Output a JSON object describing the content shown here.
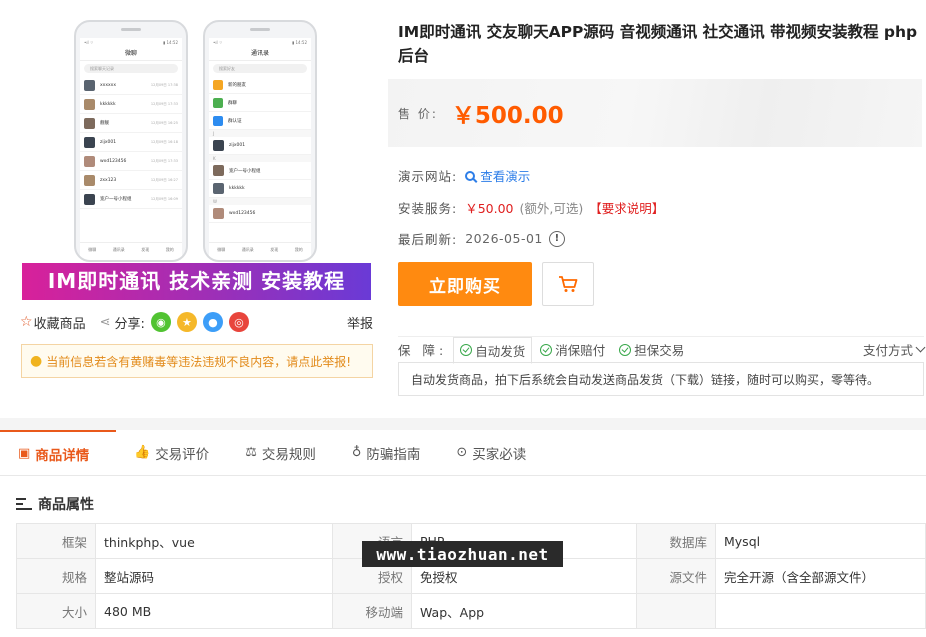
{
  "gallery": {
    "phone1": {
      "title": "微聊",
      "search_placeholder": "搜索聊天记录",
      "chats": [
        {
          "name": "xxxxxx",
          "time": "12月09日 17:38"
        },
        {
          "name": "kkkkkk",
          "time": "12月09日 17:33"
        },
        {
          "name": "靓靓",
          "time": "12月09日 16:25"
        },
        {
          "name": "zijx001",
          "time": "12月09日 16:18"
        },
        {
          "name": "wxd123456",
          "time": "12月09日 17:33"
        },
        {
          "name": "zxx123",
          "time": "12月09日 16:27"
        },
        {
          "name": "宽户一号小程组",
          "time": "12月09日 16:09"
        }
      ],
      "tabs": [
        "微聊",
        "通讯录",
        "发现",
        "我的"
      ]
    },
    "phone2": {
      "title": "通讯录",
      "search_placeholder": "搜索好友",
      "contacts": [
        {
          "name": "新的朋友",
          "color": "o"
        },
        {
          "name": "群聊",
          "color": "g"
        },
        {
          "name": "群认证",
          "color": "b"
        }
      ],
      "groups": [
        {
          "letter": "J",
          "name": "zijx001"
        },
        {
          "letter": "K",
          "name": "宽户一号小程组"
        },
        {
          "letter": "",
          "name": "kkkkkk"
        },
        {
          "letter": "W",
          "name": "wxd123456"
        }
      ],
      "tabs": [
        "微聊",
        "通讯录",
        "发现",
        "我的"
      ]
    },
    "banner_text": "IM即时通讯 技术亲测 安装教程"
  },
  "share": {
    "favorite_label": "收藏商品",
    "share_label": "分享:",
    "report_label": "举报"
  },
  "notice": "当前信息若含有黄赌毒等违法违规不良内容，请点此举报!",
  "product": {
    "title": "IM即时通讯 交友聊天APP源码 音视频通讯 社交通讯 带视频安装教程 php后台",
    "price_label": "售 价:",
    "price": "￥500.00",
    "demo_label": "演示网站:",
    "demo_link": "查看演示",
    "service_label": "安装服务:",
    "service_price": "￥50.00",
    "service_note": "(额外,可选)",
    "service_req": "【要求说明】",
    "refresh_label": "最后刷新:",
    "refresh_date": "2026-05-01",
    "buy_label": "立即购买"
  },
  "guarantee": {
    "label": "保 障:",
    "items": [
      "自动发货",
      "消保赔付",
      "担保交易"
    ],
    "pay_method": "支付方式",
    "description": "自动发货商品，拍下后系统会自动发送商品发货（下载）链接，随时可以购买，零等待。"
  },
  "tabs": [
    "商品详情",
    "交易评价",
    "交易规则",
    "防骗指南",
    "买家必读"
  ],
  "attributes": {
    "heading": "商品属性",
    "rows": [
      [
        {
          "k": "框架",
          "v": "thinkphp、vue"
        },
        {
          "k": "语言",
          "v": "PHP"
        },
        {
          "k": "数据库",
          "v": "Mysql"
        }
      ],
      [
        {
          "k": "规格",
          "v": "整站源码"
        },
        {
          "k": "授权",
          "v": "免授权"
        },
        {
          "k": "源文件",
          "v": "完全开源（含全部源文件）"
        }
      ],
      [
        {
          "k": "大小",
          "v": "480 MB"
        },
        {
          "k": "移动端",
          "v": "Wap、App"
        },
        {
          "k": "",
          "v": ""
        }
      ]
    ]
  },
  "watermark": "www.tiaozhuan.net",
  "colors": {
    "accent": "#ff5b00",
    "buy_button": "#ff8a10",
    "tab_active": "#e9591b",
    "link": "#2d7ee8",
    "guarantee_check": "#38a84a"
  }
}
